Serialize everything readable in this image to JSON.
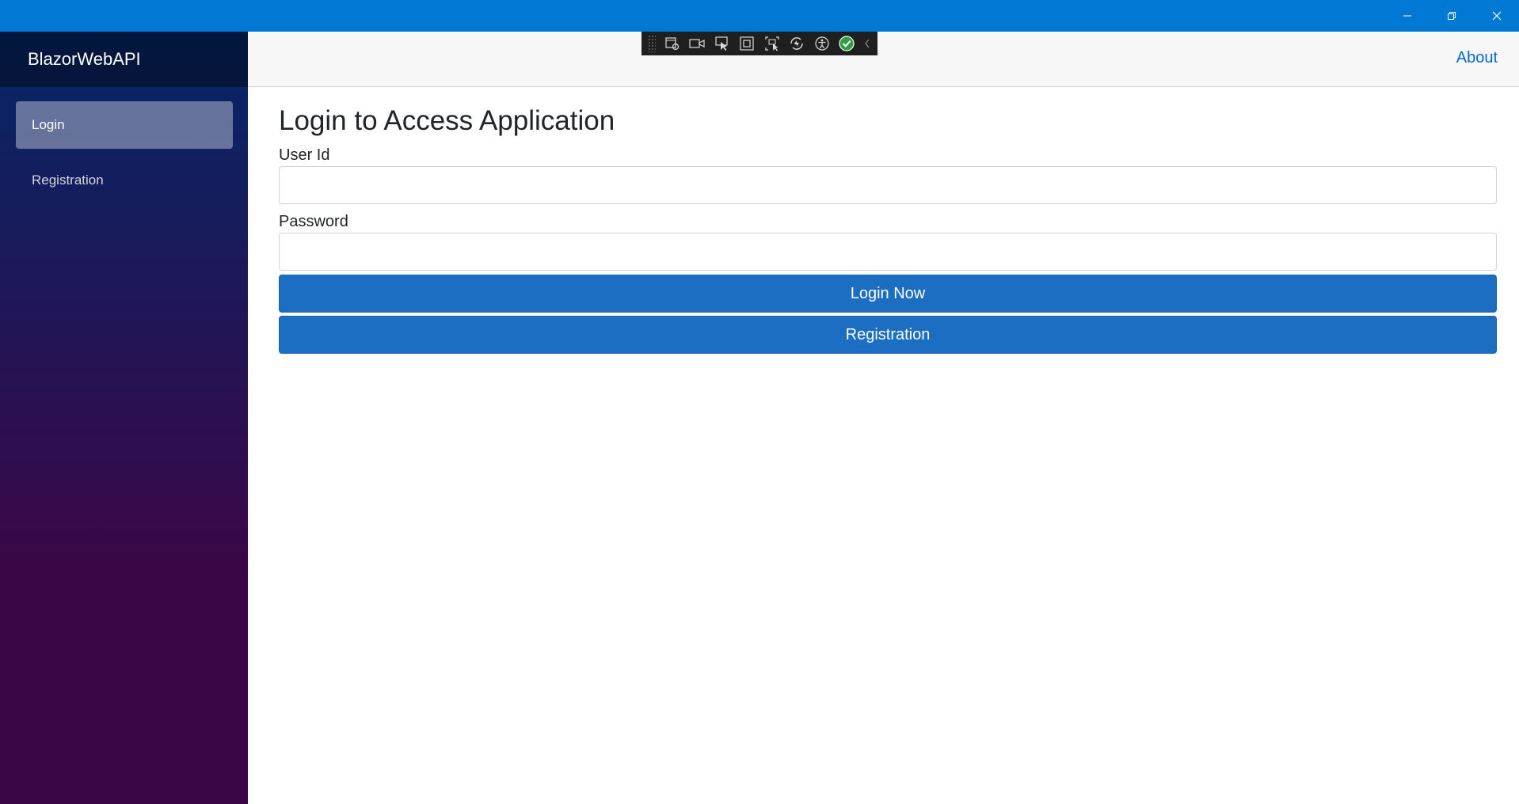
{
  "window": {
    "title_bar_color": "#0078d4",
    "controls": [
      "minimize-icon",
      "restore-icon",
      "close-icon"
    ]
  },
  "sidebar": {
    "brand": "BlazorWebAPI",
    "items": [
      {
        "label": "Login",
        "active": true
      },
      {
        "label": "Registration",
        "active": false
      }
    ]
  },
  "top_row": {
    "about_link": "About"
  },
  "dev_toolbar": {
    "icons": [
      "live-visual-tree-icon",
      "record-icon",
      "select-element-icon",
      "display-layout-adorners-icon",
      "track-focus-icon",
      "hot-reload-icon",
      "accessibility-icon",
      "binding-check-icon",
      "collapse-chevron-icon"
    ]
  },
  "main": {
    "title": "Login to Access Application",
    "user_id_label": "User Id",
    "user_id_value": "",
    "password_label": "Password",
    "password_value": "",
    "login_button": "Login Now",
    "registration_button": "Registration"
  },
  "colors": {
    "accent": "#1b6ec2",
    "link": "#0366d6",
    "sidebar_top": "#052767",
    "sidebar_bottom": "#3a0647"
  }
}
